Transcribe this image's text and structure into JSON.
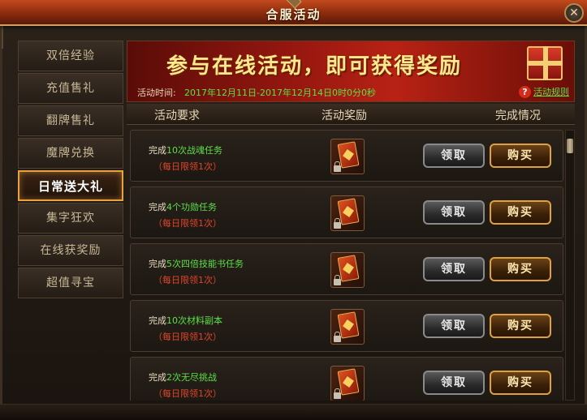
{
  "window": {
    "title": "合服活动",
    "close_symbol": "✕"
  },
  "sidebar": {
    "items": [
      {
        "label": "双倍经验",
        "active": false
      },
      {
        "label": "充值售礼",
        "active": false
      },
      {
        "label": "翻牌售礼",
        "active": false
      },
      {
        "label": "魔牌兑换",
        "active": false
      },
      {
        "label": "日常送大礼",
        "active": true
      },
      {
        "label": "集字狂欢",
        "active": false
      },
      {
        "label": "在线获奖励",
        "active": false
      },
      {
        "label": "超值寻宝",
        "active": false
      }
    ]
  },
  "banner": {
    "slogan": "参与在线活动，即可获得奖励",
    "time_label": "活动时间:",
    "time_value": "2017年12月11日-2017年12月14日0时0分0秒",
    "rules_icon": "?",
    "rules_label": "活动规则"
  },
  "table": {
    "headers": {
      "requirement": "活动要求",
      "reward": "活动奖励",
      "status": "完成情况"
    },
    "rows": [
      {
        "prefix": "完成",
        "highlight": "10次战魂任务",
        "limit": "（每日限领1次）",
        "claim": "领取",
        "buy": "购买"
      },
      {
        "prefix": "完成",
        "highlight": "4个功勋任务",
        "limit": "（每日限领1次）",
        "claim": "领取",
        "buy": "购买"
      },
      {
        "prefix": "完成",
        "highlight": "5次四倍技能书任务",
        "limit": "（每日限领1次）",
        "claim": "领取",
        "buy": "购买"
      },
      {
        "prefix": "完成",
        "highlight": "10次材料副本",
        "limit": "（每日限领1次）",
        "claim": "领取",
        "buy": "购买"
      },
      {
        "prefix": "完成",
        "highlight": "2次无尽挑战",
        "limit": "（每日限领1次）",
        "claim": "领取",
        "buy": "购买"
      }
    ]
  },
  "colors": {
    "highlight_text": "#5ce048",
    "limit_text": "#e0452a",
    "active_border": "#e8a040",
    "title_bar": "#8a2a0e"
  },
  "icons": {
    "close": "close-icon",
    "rules": "question-icon",
    "reward": "card-reward-icon",
    "lock": "lock-icon",
    "gift": "gift-box-icon"
  }
}
